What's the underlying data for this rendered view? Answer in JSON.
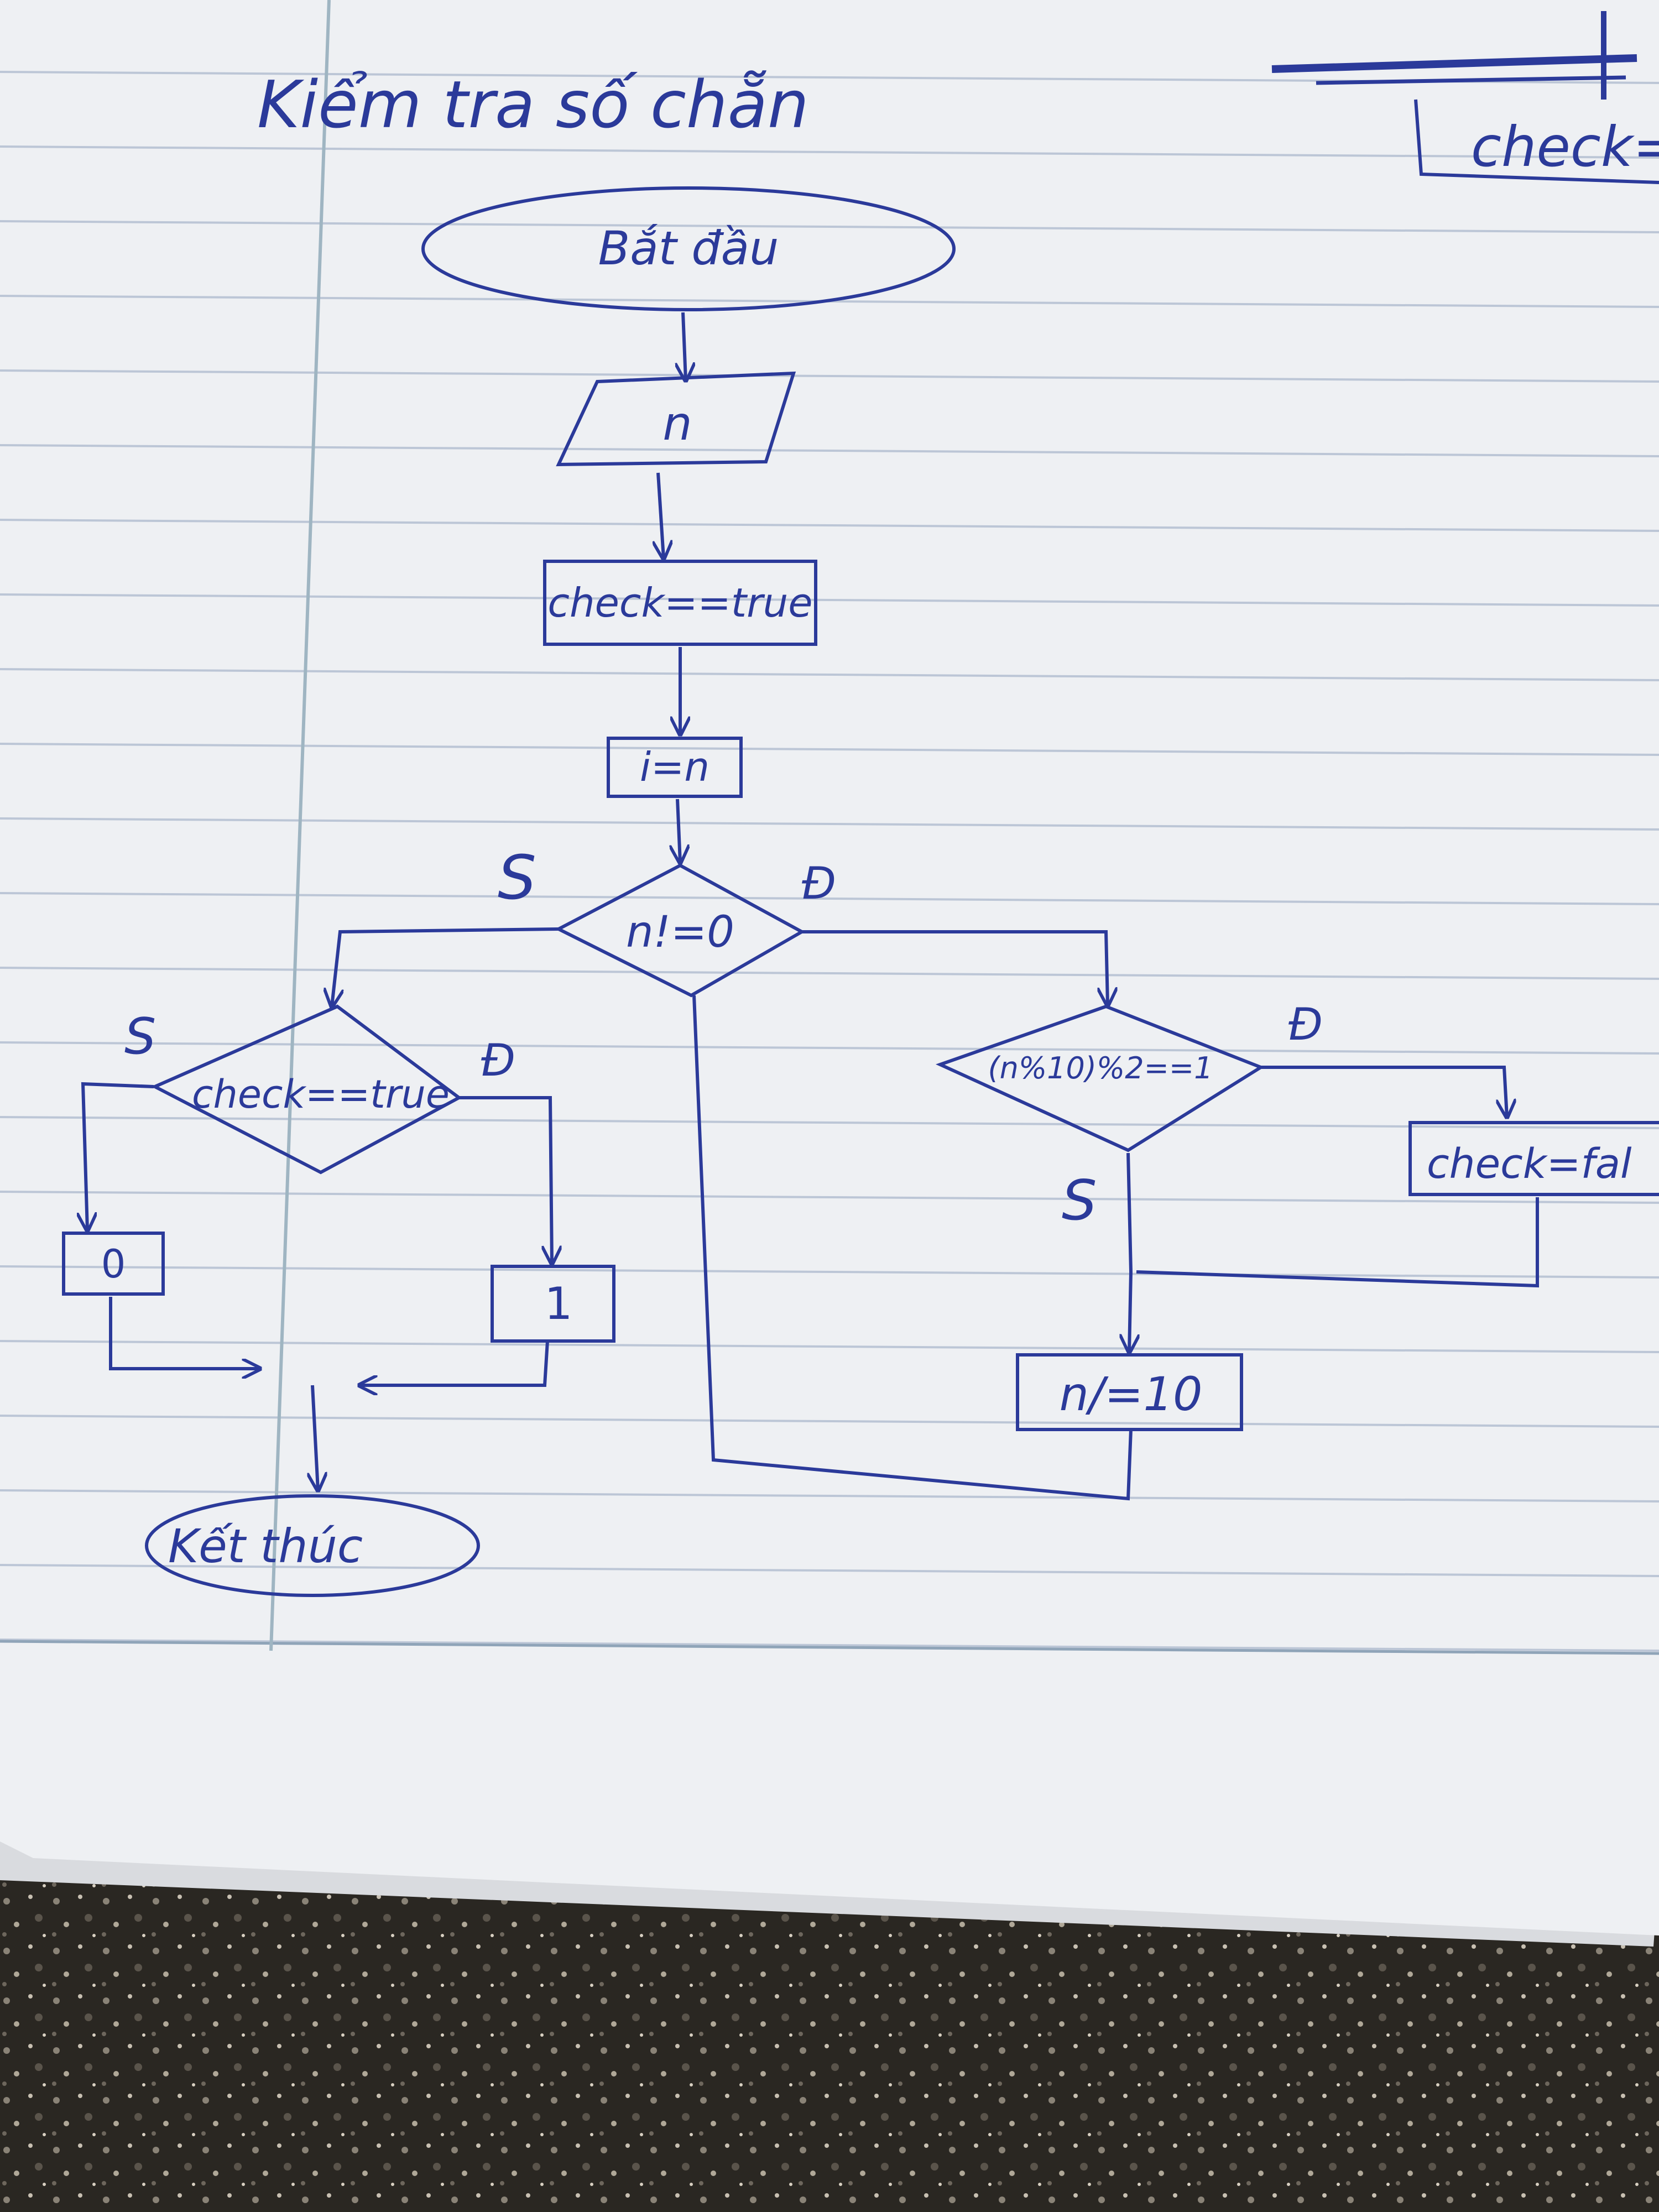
{
  "page": {
    "title": "Kiểm tra số chẵn",
    "corner_fragment": "check="
  },
  "colors": {
    "ink": "#2b3a9a",
    "paper": "#eef0f3",
    "rule_line": "#bcc6d6",
    "margin_line": "#9fb5c2",
    "granite": "#2a2722"
  },
  "flowchart": {
    "start": "Bắt đầu",
    "input": "n",
    "init_check": "check==true",
    "assign_i": "i=n",
    "loop_condition": "n!=0",
    "parity_condition": "(n%10)%2==1",
    "set_false": "check=fal",
    "divide": "n/=10",
    "final_condition": "check==true",
    "output_false": "0",
    "output_true": "1",
    "end": "Kết thúc"
  },
  "branch_labels": {
    "loop_false": "S",
    "loop_true": "Đ",
    "parity_true": "Đ",
    "parity_false": "S",
    "final_false": "S",
    "final_true": "Đ"
  }
}
